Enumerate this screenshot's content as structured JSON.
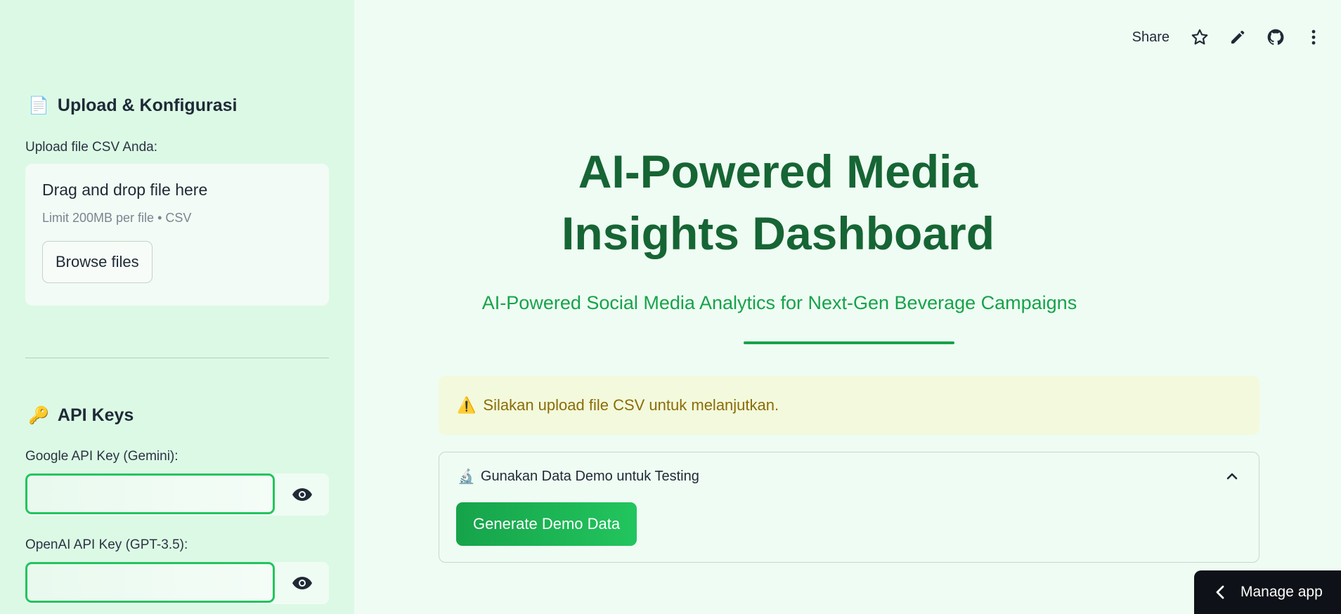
{
  "sidebar": {
    "upload_heading": {
      "emoji": "📄",
      "text": "Upload & Konfigurasi"
    },
    "upload_label": "Upload file CSV Anda:",
    "uploader": {
      "drag_text": "Drag and drop file here",
      "limit_text": "Limit 200MB per file • CSV",
      "browse_label": "Browse files"
    },
    "api_heading": {
      "emoji": "🔑",
      "text": "API Keys"
    },
    "google_key": {
      "label": "Google API Key (Gemini):",
      "value": ""
    },
    "openai_key": {
      "label": "OpenAI API Key (GPT-3.5):",
      "value": ""
    }
  },
  "toolbar": {
    "share_label": "Share",
    "icons": [
      "star-icon",
      "pencil-icon",
      "github-icon",
      "more-vertical-icon"
    ]
  },
  "main": {
    "title": "AI-Powered Media Insights Dashboard",
    "subtitle": "AI-Powered Social Media Analytics for Next-Gen Beverage Campaigns",
    "warning": {
      "emoji": "⚠️",
      "text": "Silakan upload file CSV untuk melanjutkan."
    },
    "expander": {
      "emoji": "🔬",
      "title": "Gunakan Data Demo untuk Testing",
      "button_label": "Generate Demo Data"
    }
  },
  "manage_app": {
    "label": "Manage app"
  },
  "colors": {
    "primary": "#16a34a",
    "title": "#166534",
    "sidebar_bg": "#dcf9e6",
    "main_bg": "#effcf3",
    "warning_bg": "#f3f9dc",
    "warning_text": "#8a6d07"
  }
}
